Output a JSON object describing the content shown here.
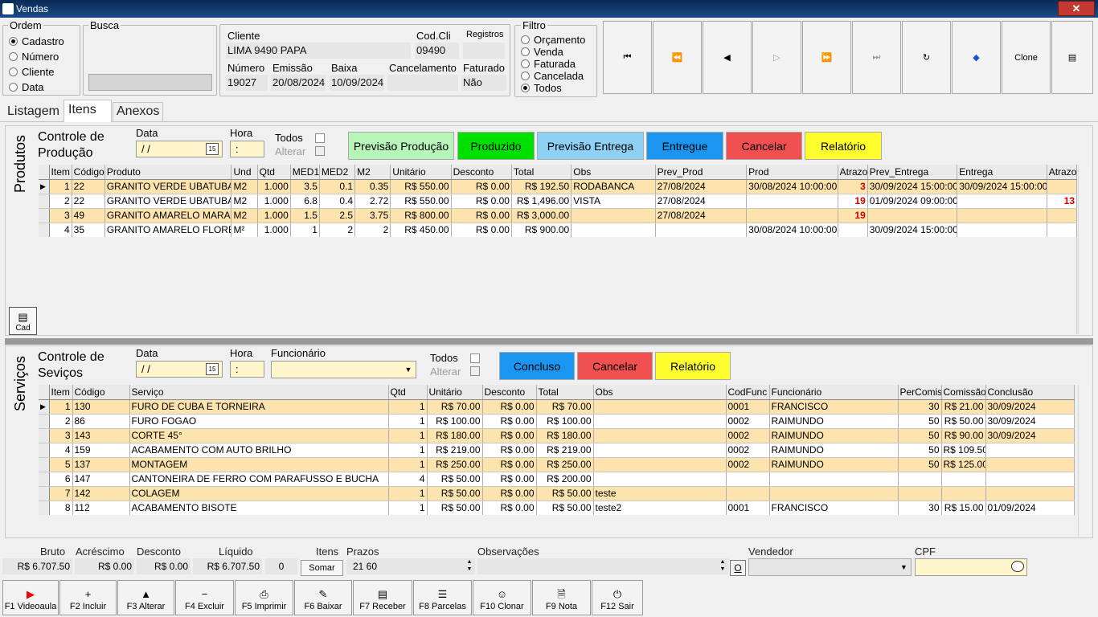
{
  "window": {
    "title": "Vendas",
    "close": "✕"
  },
  "ordem": {
    "label": "Ordem",
    "options": [
      "Cadastro",
      "Número",
      "Cliente",
      "Data"
    ],
    "selected": 0
  },
  "busca": {
    "label": "Busca",
    "value": ""
  },
  "header": {
    "cliente_label": "Cliente",
    "cliente": "LIMA 9490 PAPA",
    "codcli_label": "Cod.Cli",
    "codcli": "09490",
    "registros_label": "Registros",
    "registros": "",
    "numero_label": "Número",
    "numero": "19027",
    "emissao_label": "Emissão",
    "emissao": "20/08/2024",
    "baixa_label": "Baixa",
    "baixa": "10/09/2024",
    "cancel_label": "Cancelamento",
    "cancel": "",
    "faturado_label": "Faturado",
    "faturado": "Não"
  },
  "filtro": {
    "label": "Filtro",
    "options": [
      "Orçamento",
      "Venda",
      "Faturada",
      "Cancelada",
      "Todos"
    ],
    "selected": 4
  },
  "nav": [
    {
      "name": "first-record-icon",
      "glyph": "⏮"
    },
    {
      "name": "prev-page-icon",
      "glyph": "⏪"
    },
    {
      "name": "prev-record-icon",
      "glyph": "◀"
    },
    {
      "name": "next-record-icon",
      "glyph": "▷"
    },
    {
      "name": "next-page-icon",
      "glyph": "⏩"
    },
    {
      "name": "last-record-icon",
      "glyph": "⏭"
    },
    {
      "name": "refresh-icon",
      "glyph": "↻"
    },
    {
      "name": "tag-icon",
      "glyph": "◆"
    },
    {
      "name": "clone-icon",
      "glyph": "Clone"
    },
    {
      "name": "form-icon",
      "glyph": "▤"
    }
  ],
  "tabs": [
    "Listagem",
    "Itens",
    "Anexos"
  ],
  "produtos": {
    "side": "Produtos",
    "title1": "Controle de",
    "title2": "Produção",
    "data_label": "Data",
    "data": "/ /",
    "hora_label": "Hora",
    "hora": ":",
    "todos": "Todos",
    "alterar": "Alterar",
    "cad": "Cad",
    "buttons": [
      {
        "label": "Previsão Produção",
        "color": "#b8f5b8"
      },
      {
        "label": "Produzido",
        "color": "#00e000"
      },
      {
        "label": "Previsão Entrega",
        "color": "#8fd0f5"
      },
      {
        "label": "Entregue",
        "color": "#1a96f0"
      },
      {
        "label": "Cancelar",
        "color": "#f05050"
      },
      {
        "label": "Relatório",
        "color": "#ffff30"
      }
    ],
    "columns": [
      "Item",
      "Código",
      "Produto",
      "Und",
      "Qtd",
      "MED1",
      "MED2",
      "M2",
      "Unitário",
      "Desconto",
      "Total",
      "Obs",
      "Prev_Prod",
      "Prod",
      "Atrazo",
      "Prev_Entrega",
      "Entrega",
      "Atrazo"
    ],
    "rows": [
      [
        "1",
        "22",
        "GRANITO VERDE UBATUBA",
        "M2",
        "1.000",
        "3.5",
        "0.1",
        "0.35",
        "R$ 550.00",
        "R$ 0.00",
        "R$ 192.50",
        "RODABANCA",
        "27/08/2024",
        "30/08/2024 10:00:00",
        "3",
        "30/09/2024 15:00:00",
        "30/09/2024 15:00:00",
        ""
      ],
      [
        "2",
        "22",
        "GRANITO VERDE UBATUBA",
        "M2",
        "1.000",
        "6.8",
        "0.4",
        "2.72",
        "R$ 550.00",
        "R$ 0.00",
        "R$ 1,496.00",
        "VISTA",
        "27/08/2024",
        "",
        "19",
        "01/09/2024 09:00:00",
        "",
        "13"
      ],
      [
        "3",
        "49",
        "GRANITO AMARELO MARACU",
        "M2",
        "1.000",
        "1.5",
        "2.5",
        "3.75",
        "R$ 800.00",
        "R$ 0.00",
        "R$ 3,000.00",
        "",
        "27/08/2024",
        "",
        "19",
        "",
        "",
        ""
      ],
      [
        "4",
        "35",
        "GRANITO AMARELO FLOREN(",
        "M²",
        "1.000",
        "1",
        "2",
        "2",
        "R$ 450.00",
        "R$ 0.00",
        "R$ 900.00",
        "",
        "",
        "30/08/2024 10:00:00",
        "",
        "30/09/2024 15:00:00",
        "",
        ""
      ]
    ]
  },
  "servicos": {
    "side": "Serviços",
    "title1": "Controle de",
    "title2": "Seviços",
    "data_label": "Data",
    "data": "/ /",
    "hora_label": "Hora",
    "hora": ":",
    "func_label": "Funcionário",
    "todos": "Todos",
    "alterar": "Alterar",
    "buttons": [
      {
        "label": "Concluso",
        "color": "#1a96f0"
      },
      {
        "label": "Cancelar",
        "color": "#f05050"
      },
      {
        "label": "Relatório",
        "color": "#ffff30"
      }
    ],
    "columns": [
      "Item",
      "Código",
      "Serviço",
      "Qtd",
      "Unitário",
      "Desconto",
      "Total",
      "Obs",
      "CodFunc",
      "Funcionário",
      "PerComiss",
      "Comissão",
      "Conclusão"
    ],
    "rows": [
      [
        "1",
        "130",
        "FURO DE CUBA E TORNEIRA",
        "1",
        "R$ 70.00",
        "R$ 0.00",
        "R$ 70.00",
        "",
        "0001",
        "FRANCISCO",
        "30",
        "R$ 21.00",
        "30/09/2024"
      ],
      [
        "2",
        "86",
        "FURO FOGAO",
        "1",
        "R$ 100.00",
        "R$ 0.00",
        "R$ 100.00",
        "",
        "0002",
        "RAIMUNDO",
        "50",
        "R$ 50.00",
        "30/09/2024"
      ],
      [
        "3",
        "143",
        "CORTE 45°",
        "1",
        "R$ 180.00",
        "R$ 0.00",
        "R$ 180.00",
        "",
        "0002",
        "RAIMUNDO",
        "50",
        "R$ 90.00",
        "30/09/2024"
      ],
      [
        "4",
        "159",
        "ACABAMENTO COM AUTO BRILHO",
        "1",
        "R$ 219.00",
        "R$ 0.00",
        "R$ 219.00",
        "",
        "0002",
        "RAIMUNDO",
        "50",
        "R$ 109.50",
        ""
      ],
      [
        "5",
        "137",
        "MONTAGEM",
        "1",
        "R$ 250.00",
        "R$ 0.00",
        "R$ 250.00",
        "",
        "0002",
        "RAIMUNDO",
        "50",
        "R$ 125.00",
        ""
      ],
      [
        "6",
        "147",
        "CANTONEIRA DE FERRO COM PARAFUSSO E BUCHA",
        "4",
        "R$ 50.00",
        "R$ 0.00",
        "R$ 200.00",
        "",
        "",
        "",
        "",
        "",
        ""
      ],
      [
        "7",
        "142",
        "COLAGEM",
        "1",
        "R$ 50.00",
        "R$ 0.00",
        "R$ 50.00",
        "teste",
        "",
        "",
        "",
        "",
        ""
      ],
      [
        "8",
        "112",
        "ACABAMENTO BISOTE",
        "1",
        "R$ 50.00",
        "R$ 0.00",
        "R$ 50.00",
        "teste2",
        "0001",
        "FRANCISCO",
        "30",
        "R$ 15.00",
        "01/09/2024"
      ]
    ]
  },
  "totals": {
    "bruto_label": "Bruto",
    "bruto": "R$ 6.707.50",
    "acres_label": "Acréscimo",
    "acres": "R$ 0.00",
    "desc_label": "Desconto",
    "desc": "R$ 0.00",
    "liq_label": "Líquido",
    "liq": "R$ 6.707.50",
    "itens_label": "Itens",
    "itens": "0",
    "somar": "Somar",
    "prazos_label": "Prazos",
    "prazos": "21   60",
    "obs_label": "Observações",
    "vendedor_label": "Vendedor",
    "cpf_label": "CPF",
    "o_btn": "O"
  },
  "fkeys": [
    {
      "label": "F1 Videoaula",
      "icon": "▶",
      "name": "video-icon"
    },
    {
      "label": "F2 Incluir",
      "icon": "+",
      "name": "plus-icon"
    },
    {
      "label": "F3 Alterar",
      "icon": "▲",
      "name": "up-icon"
    },
    {
      "label": "F4 Excluir",
      "icon": "−",
      "name": "minus-icon"
    },
    {
      "label": "F5 Imprimir",
      "icon": "⎙",
      "name": "printer-icon"
    },
    {
      "label": "F6 Baixar",
      "icon": "✎",
      "name": "check-doc-icon"
    },
    {
      "label": "F7 Receber",
      "icon": "▤",
      "name": "receipt-icon"
    },
    {
      "label": "F8 Parcelas",
      "icon": "☰",
      "name": "list-icon"
    },
    {
      "label": "F10 Clonar",
      "icon": "☺",
      "name": "clone-icon"
    },
    {
      "label": "F9 Nota",
      "icon": "🗎",
      "name": "note-icon"
    },
    {
      "label": "F12 Sair",
      "icon": "⏻",
      "name": "exit-icon"
    }
  ]
}
